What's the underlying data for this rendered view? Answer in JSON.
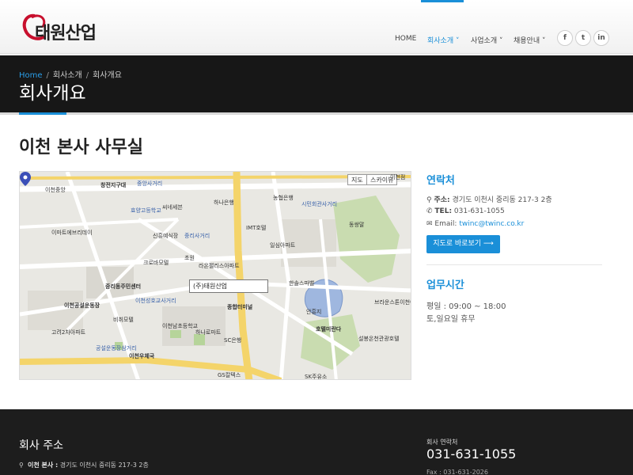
{
  "header": {
    "logo_text": "태원산업",
    "nav": [
      {
        "label": "HOME"
      },
      {
        "label": "회사소개 ˅"
      },
      {
        "label": "사업소개 ˅"
      },
      {
        "label": "채용안내 ˅"
      }
    ],
    "social": [
      {
        "name": "facebook-icon",
        "glyph": "f"
      },
      {
        "name": "twitter-icon",
        "glyph": "t"
      },
      {
        "name": "linkedin-icon",
        "glyph": "in"
      }
    ]
  },
  "breadcrumb": {
    "home": "Home",
    "level1": "회사소개",
    "level2": "회사개요"
  },
  "page_title": "회사개요",
  "main_heading": "이천 본사 사무실",
  "map": {
    "type_buttons": [
      "지도",
      "스카이뷰"
    ],
    "info_label": "(주)태원산업",
    "labels": [
      "창전지구대",
      "중앙사거리",
      "이천중앙",
      "하나은행",
      "씨네세븐",
      "농협은행",
      "시민회관사거리",
      "효양고등학교",
      "이마트에브리데이",
      "IMT호텔",
      "신흥예식장",
      "중리사거리",
      "일심아파트",
      "동쌍말",
      "크로바모텔",
      "초원",
      "라온팰리스아파트",
      "중리동주민센터",
      "이천점",
      "한솔스파밸",
      "이천공설운동장",
      "이천성호교사거리",
      "비취모텔",
      "브라운스톤이천아파트",
      "고려2차아파트",
      "하나로마트",
      "이천남초등학교",
      "종합터미널",
      "안흥지",
      "호텔미란다",
      "공설운동장삼거리",
      "이천우체국",
      "SC은행",
      "설봉온천관광호텔",
      "GS칼텍스",
      "SK주유소"
    ]
  },
  "contact": {
    "heading": "연락처",
    "address_label": "주소:",
    "address": "경기도 이천시 중리동 217-3 2층",
    "tel_label": "TEL:",
    "tel": "031-631-1055",
    "email_label": "Email:",
    "email": "twinc@twinc.co.kr",
    "map_button": "지도로 바로보기 ⟶"
  },
  "hours": {
    "heading": "업무시간",
    "weekday": "평일 : 09:00 ~ 18:00",
    "weekend": "토,일요일 휴무"
  },
  "footer": {
    "address_title": "회사 주소",
    "office_label": "이천 본사 :",
    "office_address": "경기도 이천시 중리동 217-3 2층",
    "contact_label": "회사 연락처",
    "phone": "031-631-1055",
    "fax": "Fax : 031-631-2026"
  },
  "colors": {
    "accent": "#1a8fd8",
    "dark_band": "#171717",
    "footer": "#1d1d1d"
  }
}
